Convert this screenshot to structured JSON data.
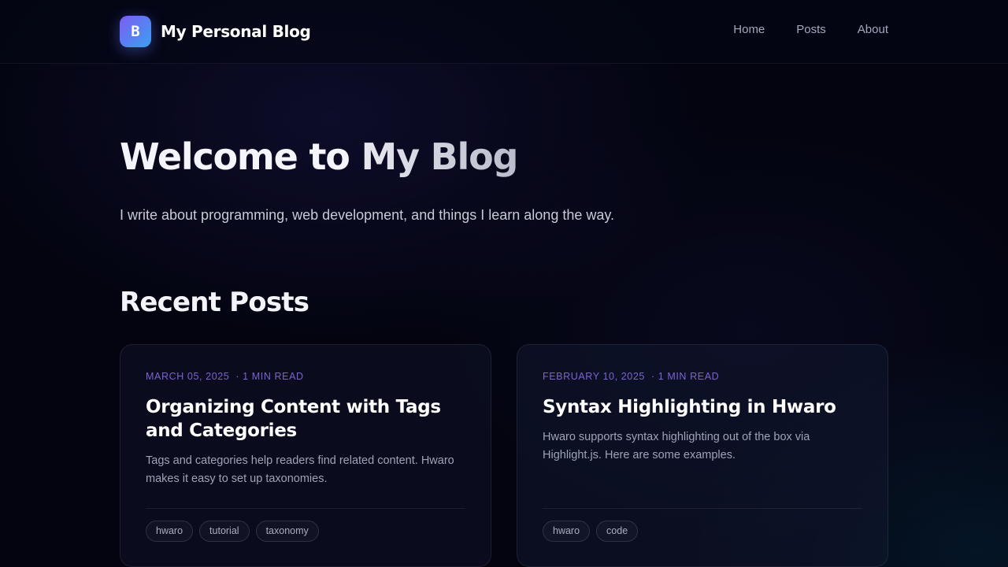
{
  "header": {
    "logo_letter": "B",
    "site_title": "My Personal Blog",
    "nav": [
      {
        "label": "Home"
      },
      {
        "label": "Posts"
      },
      {
        "label": "About"
      }
    ]
  },
  "hero": {
    "title_part1": "Welcome to ",
    "title_part2": "My Blog",
    "subtitle": "I write about programming, web development, and things I learn along the way."
  },
  "recent": {
    "heading": "Recent Posts",
    "posts": [
      {
        "date": "MARCH 05, 2025",
        "read_time": "1 MIN READ",
        "title": "Organizing Content with Tags and Categories",
        "excerpt": "Tags and categories help readers find related content. Hwaro makes it easy to set up taxonomies.",
        "tags": [
          "hwaro",
          "tutorial",
          "taxonomy"
        ]
      },
      {
        "date": "FEBRUARY 10, 2025",
        "read_time": "1 MIN READ",
        "title": "Syntax Highlighting in Hwaro",
        "excerpt": "Hwaro supports syntax highlighting out of the box via Highlight.js. Here are some examples.",
        "tags": [
          "hwaro",
          "code"
        ]
      }
    ]
  },
  "colors": {
    "background": "#03040f",
    "accent_purple": "#7b63d6",
    "logo_gradient_start": "#7c5cf5",
    "logo_gradient_end": "#3aa0f0"
  }
}
